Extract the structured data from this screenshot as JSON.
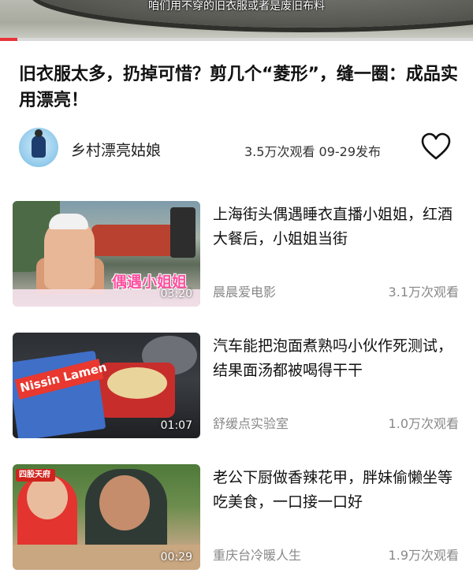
{
  "player": {
    "subtitle": "咱们用不穿的旧衣服或者是废旧布料",
    "progress_fraction": 0.036,
    "colors": {
      "accent": "#e8333a"
    }
  },
  "video": {
    "title": "旧衣服太多，扔掉可惜？剪几个“菱形”，缝一圈：成品实用漂亮！",
    "author": "乡村漂亮姑娘",
    "meta": "3.5万次观看 09-29发布",
    "like_icon": "heart-outline-icon"
  },
  "recommendations": [
    {
      "title": "上海街头偶遇睡衣直播小姐姐，红酒大餐后，小姐姐当街",
      "author": "晨晨爱电影",
      "views": "3.1万次观看",
      "duration": "03:20",
      "thumb_caption": "偶遇小姐姐"
    },
    {
      "title": "汽车能把泡面煮熟吗小伙作死测试，结果面汤都被喝得干干",
      "author": "舒缓点实验室",
      "views": "1.0万次观看",
      "duration": "01:07",
      "thumb_caption": "Nissin Lamen"
    },
    {
      "title": "老公下厨做香辣花甲，胖妹偷懒坐等吃美食，一口接一口好",
      "author": "重庆台冷暖人生",
      "views": "1.9万次观看",
      "duration": "00:29",
      "thumb_caption": "四股天府"
    }
  ]
}
